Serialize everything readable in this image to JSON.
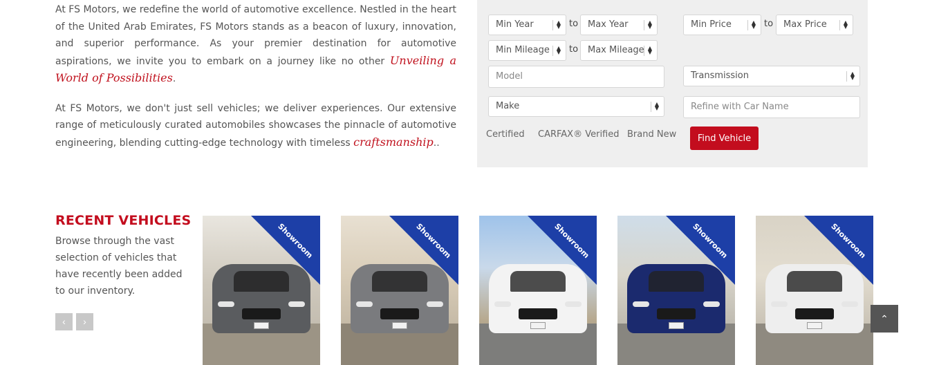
{
  "intro": {
    "p1_text": "At FS Motors, we redefine the world of automotive excellence. Nestled in the heart of the United Arab Emirates, FS Motors stands as a beacon of luxury, innovation, and superior performance. As your premier destination for automotive aspirations, we invite you to embark on a journey like no other ",
    "p1_script": "Unveiling a World of Possibilities",
    "p1_end": ".",
    "p2_text": "At FS Motors, we don't just sell vehicles; we deliver experiences. Our extensive range of meticulously curated automobiles showcases the pinnacle of automotive engineering, blending cutting-edge technology with timeless ",
    "p2_script": "craftsmanship",
    "p2_end": ".."
  },
  "search": {
    "min_year": "Min Year",
    "max_year": "Max Year",
    "min_price": "Min Price",
    "max_price": "Max Price",
    "min_mileage": "Min Mileage",
    "max_mileage": "Max Mileage",
    "to": "to",
    "model_placeholder": "Model",
    "transmission": "Transmission",
    "make": "Make",
    "car_name_placeholder": "Refine with Car Name",
    "checks": [
      "Certified",
      "CARFAX® Verified",
      "Brand New"
    ],
    "find_button": "Find Vehicle"
  },
  "recent": {
    "title": "RECENT VEHICLES",
    "description": "Browse through the vast selection of vehicles that have recently been added to our inventory.",
    "prev_icon": "‹",
    "next_icon": "›",
    "ribbon": "Showroom",
    "cars": [
      {
        "color": "#5a5c5f"
      },
      {
        "color": "#7a7b7e"
      },
      {
        "color": "#f3f3f3"
      },
      {
        "color": "#1b2a6e"
      },
      {
        "color": "#eeeeee"
      }
    ]
  },
  "scroll_top_icon": "⌃",
  "colors": {
    "accent": "#c30d1e",
    "ribbon": "#1d3fa7"
  }
}
